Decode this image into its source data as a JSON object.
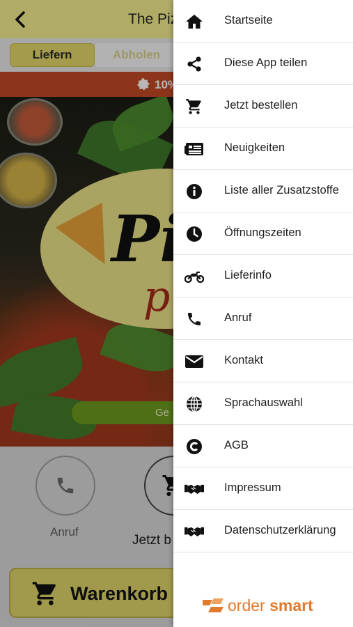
{
  "app": {
    "title": "The Piz",
    "tabs": {
      "deliver": "Liefern",
      "pickup": "Abholen"
    },
    "promo_text": "10%",
    "ordered_pill": "Ge",
    "quick_actions": {
      "call": "Anruf",
      "order": "Jetzt b"
    },
    "cart_label": "Warenkorb"
  },
  "drawer": {
    "items": [
      {
        "label": "Startseite",
        "icon": "home-icon"
      },
      {
        "label": "Diese App teilen",
        "icon": "share-icon"
      },
      {
        "label": "Jetzt bestellen",
        "icon": "cart-icon"
      },
      {
        "label": "Neuigkeiten",
        "icon": "news-icon"
      },
      {
        "label": "Liste aller Zusatzstoffe",
        "icon": "info-icon"
      },
      {
        "label": "Öffnungszeiten",
        "icon": "clock-icon"
      },
      {
        "label": "Lieferinfo",
        "icon": "motorcycle-icon"
      },
      {
        "label": "Anruf",
        "icon": "phone-icon"
      },
      {
        "label": "Kontakt",
        "icon": "envelope-icon"
      },
      {
        "label": "Sprachauswahl",
        "icon": "globe-icon"
      },
      {
        "label": "AGB",
        "icon": "copyright-icon"
      },
      {
        "label": "Impressum",
        "icon": "handshake-icon"
      },
      {
        "label": "Datenschutzerklärung",
        "icon": "handshake-icon"
      }
    ],
    "brand": {
      "part1": "order",
      "part2": "smart"
    }
  },
  "colors": {
    "topbar": "#f4ef8f",
    "accent": "#e3d96a",
    "promo": "#c24a26",
    "brand": "#e07a2e"
  }
}
